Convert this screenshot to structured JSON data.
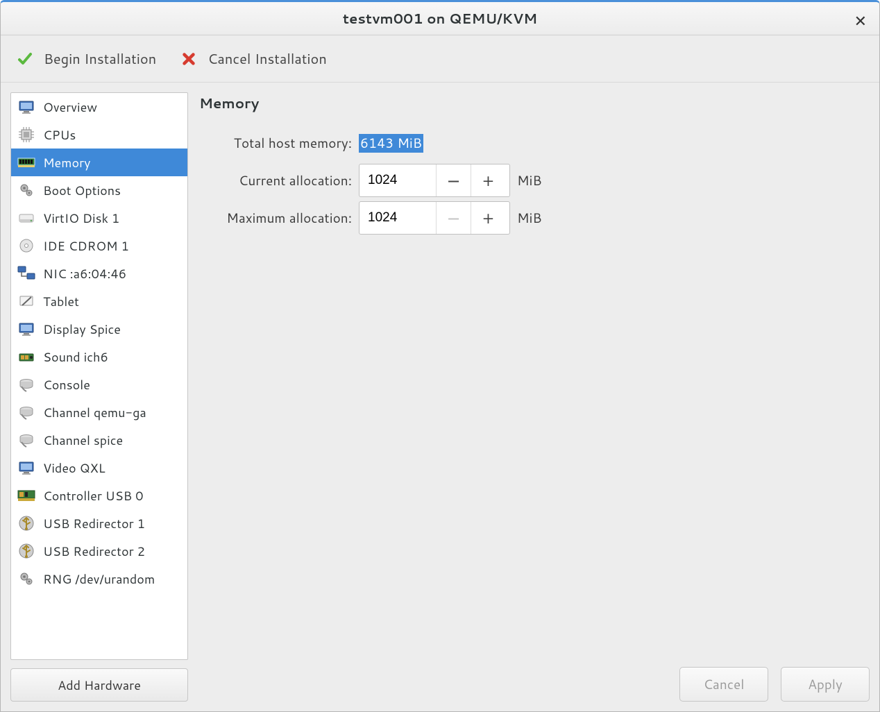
{
  "window": {
    "title": "testvm001 on QEMU/KVM"
  },
  "toolbar": {
    "begin_label": "Begin Installation",
    "cancel_label": "Cancel Installation"
  },
  "sidebar": {
    "items": [
      {
        "label": "Overview",
        "icon": "monitor",
        "selected": false
      },
      {
        "label": "CPUs",
        "icon": "cpu",
        "selected": false
      },
      {
        "label": "Memory",
        "icon": "ram",
        "selected": true
      },
      {
        "label": "Boot Options",
        "icon": "gears",
        "selected": false
      },
      {
        "label": "VirtIO Disk 1",
        "icon": "disk",
        "selected": false
      },
      {
        "label": "IDE CDROM 1",
        "icon": "cdrom",
        "selected": false
      },
      {
        "label": "NIC :a6:04:46",
        "icon": "nic",
        "selected": false
      },
      {
        "label": "Tablet",
        "icon": "tablet",
        "selected": false
      },
      {
        "label": "Display Spice",
        "icon": "monitor",
        "selected": false
      },
      {
        "label": "Sound ich6",
        "icon": "sound",
        "selected": false
      },
      {
        "label": "Console",
        "icon": "serial",
        "selected": false
      },
      {
        "label": "Channel qemu-ga",
        "icon": "serial",
        "selected": false
      },
      {
        "label": "Channel spice",
        "icon": "serial",
        "selected": false
      },
      {
        "label": "Video QXL",
        "icon": "monitor",
        "selected": false
      },
      {
        "label": "Controller USB 0",
        "icon": "pci",
        "selected": false
      },
      {
        "label": "USB Redirector 1",
        "icon": "usb",
        "selected": false
      },
      {
        "label": "USB Redirector 2",
        "icon": "usb",
        "selected": false
      },
      {
        "label": "RNG /dev/urandom",
        "icon": "gears",
        "selected": false
      }
    ],
    "add_hardware_label": "Add Hardware"
  },
  "panel": {
    "title": "Memory",
    "total_host_label": "Total host memory:",
    "total_host_value": "6143 MiB",
    "current_alloc_label": "Current allocation:",
    "current_alloc_value": "1024",
    "max_alloc_label": "Maximum allocation:",
    "max_alloc_value": "1024",
    "unit": "MiB"
  },
  "footer": {
    "cancel_label": "Cancel",
    "apply_label": "Apply"
  },
  "icons_svg": {
    "check": "<svg width='24' height='24' viewBox='0 0 24 24'><path d='M4 13 L9 18 L20 5' fill='none' stroke='#5bb93f' stroke-width='4' stroke-linecap='round' stroke-linejoin='round'/></svg>",
    "cross": "<svg width='22' height='22' viewBox='0 0 24 24'><path d='M5 5 L19 19 M19 5 L5 19' stroke='#d63b2f' stroke-width='5' stroke-linecap='round'/></svg>",
    "monitor": "<svg width='24' height='24' viewBox='0 0 24 24'><rect x='2' y='4' width='20' height='13' rx='1' fill='#3f6fb5' stroke='#2a4a7a'/><rect x='4' y='6' width='16' height='9' fill='#9fc2ee'/><rect x='8' y='18' width='8' height='2' fill='#888'/><rect x='6' y='20' width='12' height='2' fill='#aaa'/></svg>",
    "cpu": "<svg width='24' height='24' viewBox='0 0 24 24'><rect x='5' y='5' width='14' height='14' fill='#d8d8d8' stroke='#888'/><rect x='8' y='8' width='8' height='8' fill='#aaa'/><g stroke='#888' stroke-width='1'><line x1='1' y1='8' x2='5' y2='8'/><line x1='1' y1='12' x2='5' y2='12'/><line x1='1' y1='16' x2='5' y2='16'/><line x1='19' y1='8' x2='23' y2='8'/><line x1='19' y1='12' x2='23' y2='12'/><line x1='19' y1='16' x2='23' y2='16'/><line x1='8' y1='1' x2='8' y2='5'/><line x1='12' y1='1' x2='12' y2='5'/><line x1='16' y1='1' x2='16' y2='5'/><line x1='8' y1='19' x2='8' y2='23'/><line x1='12' y1='19' x2='12' y2='23'/><line x1='16' y1='19' x2='16' y2='23'/></g></svg>",
    "ram": "<svg width='26' height='16' viewBox='0 0 26 16'><rect x='1' y='2' width='24' height='10' fill='#2f7a2f' stroke='#1c4d1c'/><rect x='3' y='4' width='3' height='6' fill='#111'/><rect x='7' y='4' width='3' height='6' fill='#111'/><rect x='11' y='4' width='3' height='6' fill='#111'/><rect x='15' y='4' width='3' height='6' fill='#111'/><rect x='19' y='4' width='3' height='6' fill='#111'/><rect x='1' y='12' width='24' height='3' fill='#caa93a'/></svg>",
    "ram_sel": "<svg width='26' height='16' viewBox='0 0 26 16'><rect x='1' y='2' width='24' height='10' fill='#2f7a2f' stroke='#c9e2ff'/><rect x='3' y='4' width='3' height='6' fill='#111'/><rect x='7' y='4' width='3' height='6' fill='#111'/><rect x='11' y='4' width='3' height='6' fill='#111'/><rect x='15' y='4' width='3' height='6' fill='#111'/><rect x='19' y='4' width='3' height='6' fill='#111'/><rect x='1' y='12' width='24' height='3' fill='#e8cf6b'/></svg>",
    "gears": "<svg width='24' height='24' viewBox='0 0 24 24'><circle cx='9' cy='9' r='5' fill='#bbb' stroke='#777'/><circle cx='9' cy='9' r='1.8' fill='#777'/><circle cx='16' cy='16' r='4' fill='#bbb' stroke='#777'/><circle cx='16' cy='16' r='1.4' fill='#777'/></svg>",
    "disk": "<svg width='24' height='24' viewBox='0 0 24 24'><rect x='2' y='7' width='20' height='11' rx='2' fill='#eee' stroke='#aaa'/><rect x='2' y='14' width='20' height='4' fill='#ccc'/><circle cx='19' cy='16' r='1.3' fill='#6a6'/></svg>",
    "cdrom": "<svg width='24' height='24' viewBox='0 0 24 24'><circle cx='12' cy='12' r='9' fill='#e6e6e6' stroke='#999'/><circle cx='12' cy='12' r='2.5' fill='#fff' stroke='#999'/></svg>",
    "nic": "<svg width='26' height='24' viewBox='0 0 26 24'><rect x='1' y='2' width='11' height='8' rx='1' fill='#3f6fb5' stroke='#2a4a7a'/><rect x='14' y='12' width='11' height='8' rx='1' fill='#3f6fb5' stroke='#2a4a7a'/><path d='M6 10 V16 H14' fill='none' stroke='#666' stroke-width='1.5'/></svg>",
    "tablet": "<svg width='24' height='24' viewBox='0 0 24 24'><rect x='3' y='5' width='18' height='13' rx='1' fill='#f4f4f4' stroke='#999'/><line x1='6' y1='18' x2='19' y2='6' stroke='#666' stroke-width='2'/></svg>",
    "sound": "<svg width='24' height='24' viewBox='0 0 24 24'><rect x='2' y='8' width='20' height='10' rx='1' fill='#3a7a3a' stroke='#265226'/><rect x='4' y='10' width='5' height='6' fill='#d6a23a'/><rect x='10' y='10' width='5' height='6' fill='#d6a23a'/><circle cx='19' cy='13' r='2' fill='#222'/></svg>",
    "serial": "<svg width='24' height='24' viewBox='0 0 24 24'><ellipse cx='12' cy='8' rx='9' ry='3.5' fill='#ddd' stroke='#999'/><path d='M3 8 V14 A9 3.5 0 0 0 21 14 V8' fill='#ccc' stroke='#999'/><path d='M5 15 Q8 20 12 22' fill='none' stroke='#888' stroke-width='2'/></svg>",
    "pci": "<svg width='26' height='20' viewBox='0 0 26 20'><rect x='1' y='3' width='24' height='11' fill='#3a7a3a' stroke='#265226'/><rect x='3' y='5' width='6' height='7' fill='#d6a23a'/><rect x='11' y='5' width='4' height='7' fill='#222'/><rect x='1' y='14' width='24' height='4' fill='#caa93a'/></svg>",
    "usb": "<svg width='24' height='24' viewBox='0 0 24 24'><circle cx='12' cy='12' r='10' fill='#cfcfcf' stroke='#888'/><path d='M12 4 V20 M12 4 L9 7 M12 4 L15 7 M12 11 L7 8 M12 14 L17 11' fill='none' stroke='#a88a2a' stroke-width='2' stroke-linecap='round'/><circle cx='12' cy='20' r='2' fill='#a88a2a'/></svg>"
  }
}
